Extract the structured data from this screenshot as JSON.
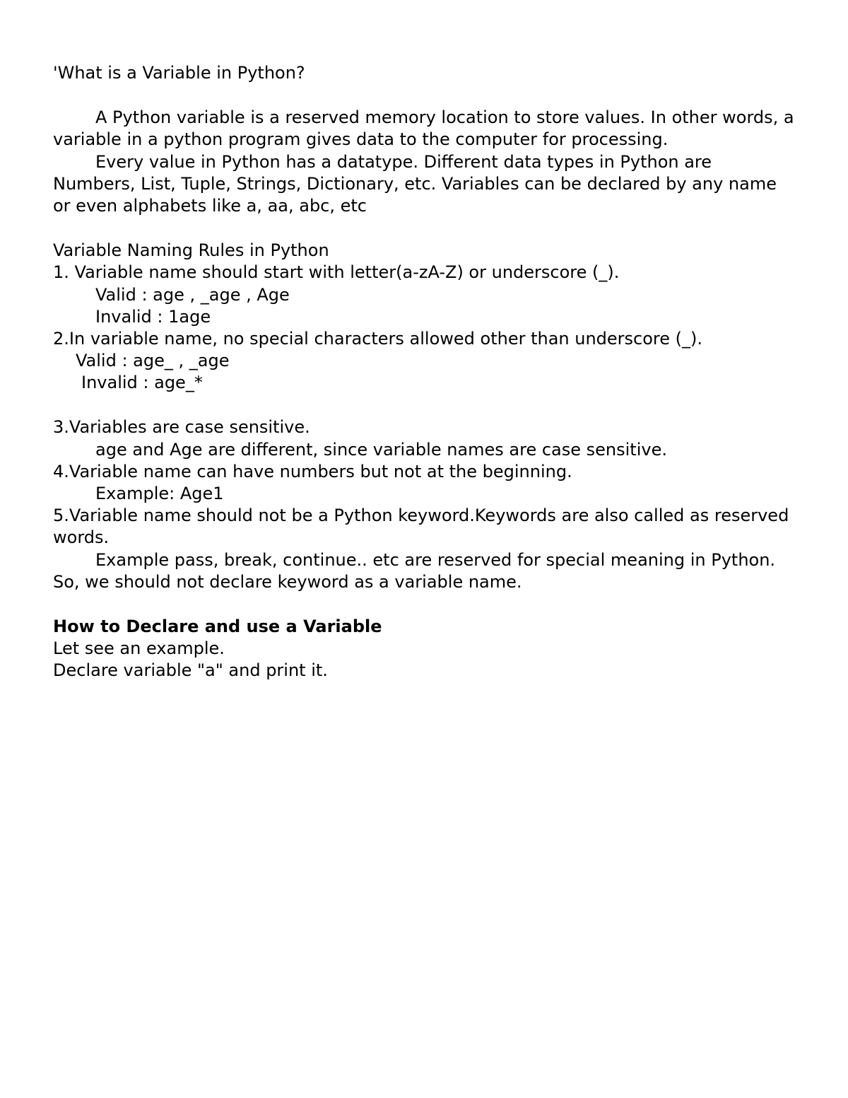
{
  "title": "'What is a Variable in Python?",
  "intro": {
    "p1": "A Python variable is a reserved memory location to store values. In other words, a variable in a python program gives data to the computer for processing.",
    "p2": "Every value in Python has a datatype. Different data types in Python are Numbers, List, Tuple, Strings, Dictionary, etc. Variables can be declared by any name or even alphabets like a, aa, abc, etc"
  },
  "rules_heading": "Variable Naming Rules in Python",
  "rule1": {
    "text": "1. Variable name should start with letter(a-zA-Z) or underscore (_).",
    "valid": "Valid : age , _age , Age",
    "invalid": "Invalid : 1age"
  },
  "rule2": {
    "text": "2.In variable name, no special characters allowed other than underscore (_).",
    "valid": "Valid : age_ , _age",
    "invalid": "Invalid : age_*"
  },
  "rule3": {
    "text": "3.Variables are case sensitive.",
    "note": "age and Age are different, since variable names are case sensitive."
  },
  "rule4": {
    "text": "4.Variable name can have numbers but not at the beginning.",
    "example": "Example: Age1"
  },
  "rule5": {
    "text": "5.Variable name should not be a Python keyword.Keywords are also called as reserved words.",
    "example": "Example pass, break, continue.. etc are reserved for special meaning in Python. So, we should not declare keyword as a variable name."
  },
  "howto": {
    "heading": "How to Declare and use a Variable",
    "line1": "Let see an example.",
    "line2": "Declare variable \"a\" and print it."
  }
}
